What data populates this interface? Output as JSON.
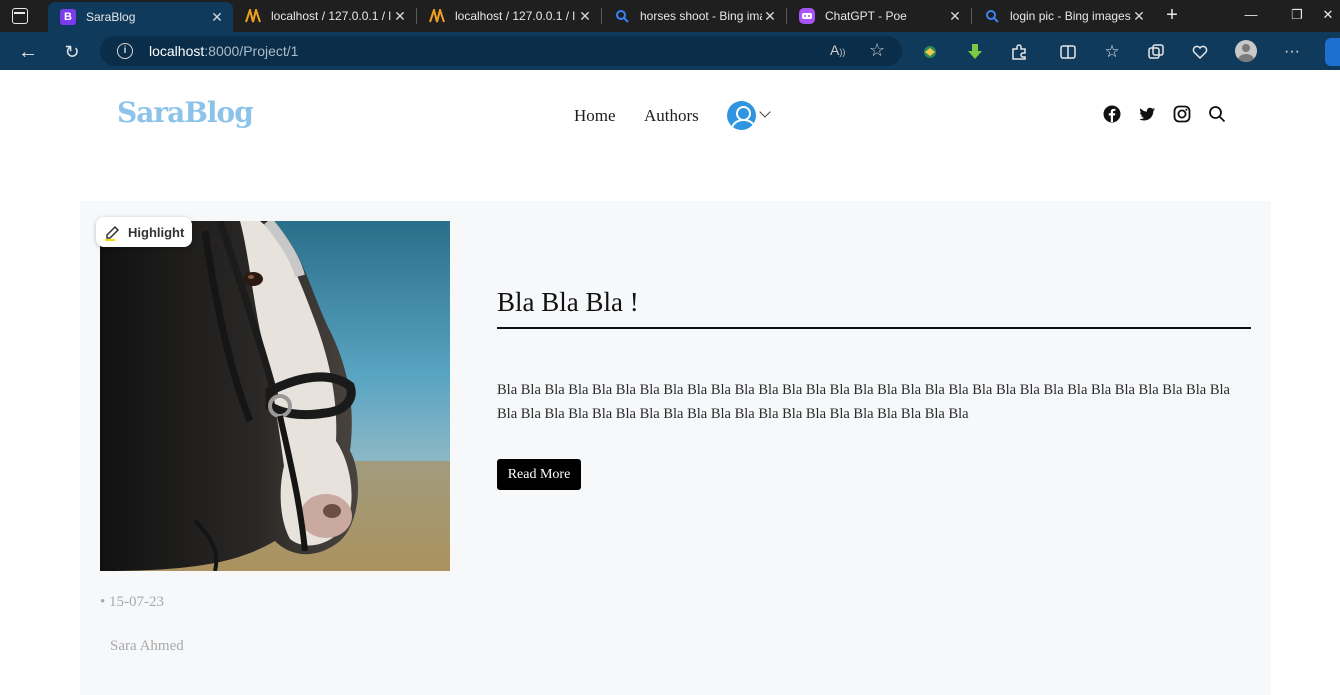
{
  "browser": {
    "tabs": [
      {
        "label": "SaraBlog",
        "favicon": "bootstrap-icon",
        "active": true
      },
      {
        "label": "localhost / 127.0.0.1 / l",
        "favicon": "phpmyadmin-icon"
      },
      {
        "label": "localhost / 127.0.0.1 / l",
        "favicon": "phpmyadmin-icon"
      },
      {
        "label": "horses shoot - Bing ima",
        "favicon": "bing-search-icon"
      },
      {
        "label": "ChatGPT - Poe",
        "favicon": "poe-icon"
      },
      {
        "label": "login pic - Bing images",
        "favicon": "bing-search-icon"
      }
    ],
    "address": {
      "host": "localhost",
      "rest": ":8000/Project/1"
    }
  },
  "site": {
    "logo": "SaraBlog",
    "nav": {
      "home": "Home",
      "authors": "Authors"
    },
    "social": [
      "facebook-icon",
      "twitter-icon",
      "instagram-icon",
      "search-icon"
    ]
  },
  "post": {
    "badge": "Highlight",
    "title": "Bla Bla Bla !",
    "excerpt": "Bla Bla Bla Bla Bla Bla Bla Bla Bla Bla Bla Bla Bla Bla Bla Bla Bla Bla Bla Bla Bla Bla Bla Bla Bla Bla Bla Bla Bla Bla Bla Bla Bla Bla Bla Bla Bla Bla Bla Bla Bla Bla Bla Bla Bla Bla Bla Bla Bla Bla Bla",
    "read_more": "Read More",
    "date": "• 15-07-23",
    "author": "Sara Ahmed"
  },
  "colors": {
    "logo": "#8cc3ea",
    "chrome": "#0f3a5c",
    "card_bg": "#f6f8fa",
    "button": "#000000"
  }
}
